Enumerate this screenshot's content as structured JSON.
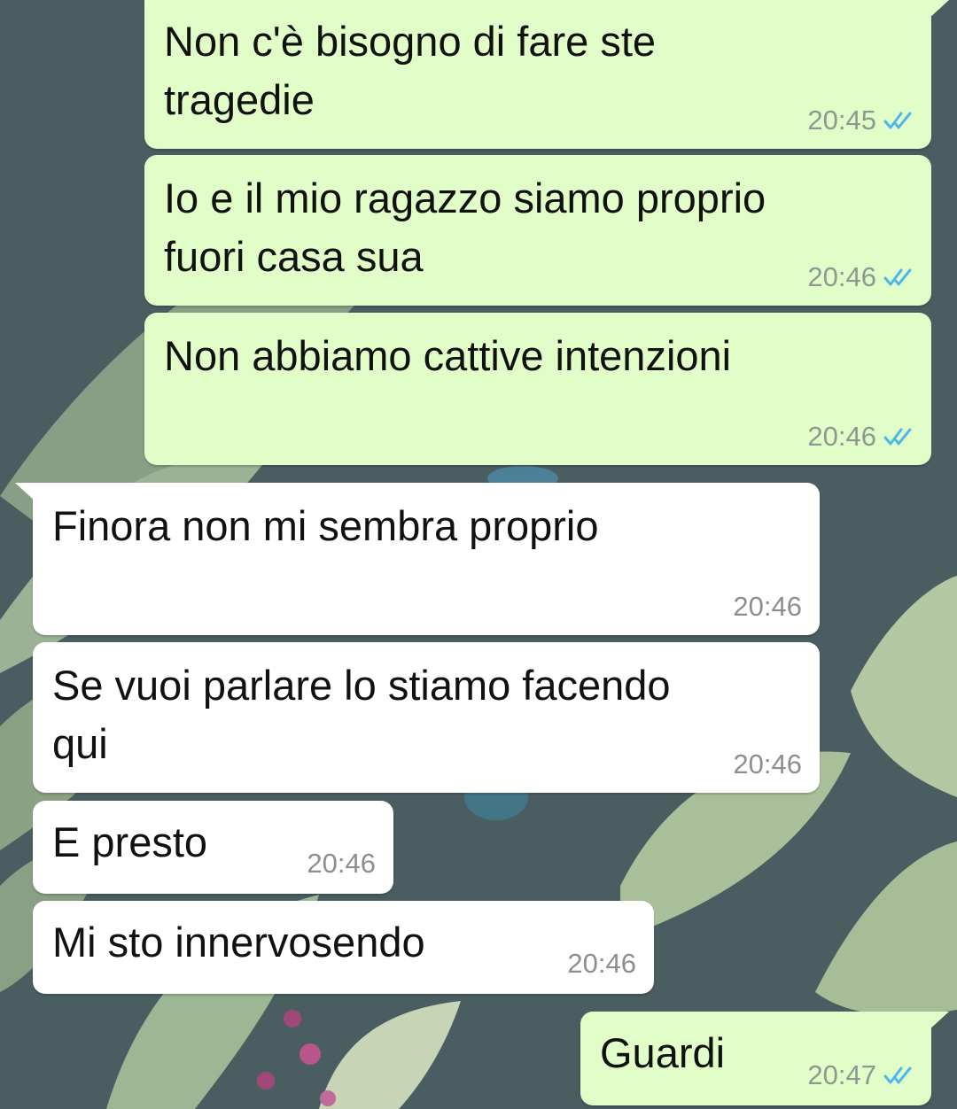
{
  "colors": {
    "outgoing_bubble": "#e2fec8",
    "incoming_bubble": "#ffffff",
    "read_ticks": "#4fb6ec",
    "timestamp": "#8f9890"
  },
  "icons": {
    "read_status": "double-check-icon"
  },
  "messages": [
    {
      "direction": "outgoing",
      "text": "Non c'è bisogno di fare ste\ntragedie",
      "time": "20:45",
      "read": true
    },
    {
      "direction": "outgoing",
      "text": "Io e il mio ragazzo siamo proprio\nfuori casa sua",
      "time": "20:46",
      "read": true
    },
    {
      "direction": "outgoing",
      "text": "Non abbiamo cattive intenzioni",
      "time": "20:46",
      "read": true
    },
    {
      "direction": "incoming",
      "text": "Finora non mi sembra proprio",
      "time": "20:46"
    },
    {
      "direction": "incoming",
      "text": "Se vuoi parlare lo stiamo facendo\nqui",
      "time": "20:46"
    },
    {
      "direction": "incoming",
      "text": "E presto",
      "time": "20:46"
    },
    {
      "direction": "incoming",
      "text": "Mi sto innervosendo",
      "time": "20:46"
    },
    {
      "direction": "outgoing",
      "text": "Guardi",
      "time": "20:47",
      "read": true
    }
  ]
}
